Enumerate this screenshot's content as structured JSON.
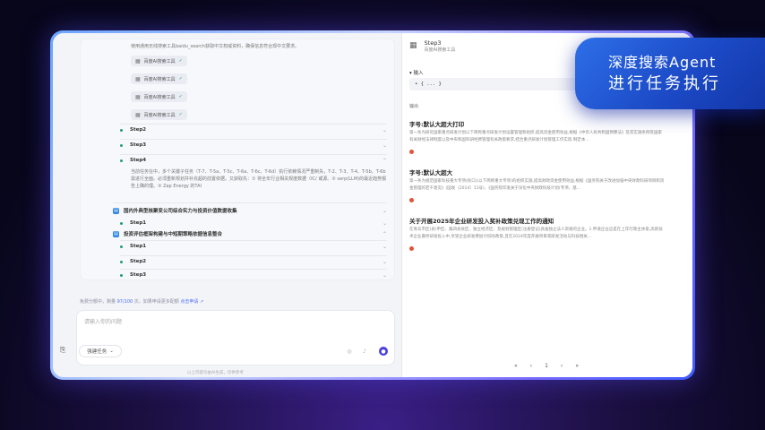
{
  "badge": {
    "line1": "深度搜索Agent",
    "line2": "进行任务执行"
  },
  "left": {
    "intro_text": "使用通用无线搜索工具baidu_search获取中文权威资料，确保信息符合现中文要求。",
    "tool_chips": [
      "百度AI搜索工具",
      "百度AI搜索工具",
      "百度AI搜索工具",
      "百度AI搜索工具"
    ],
    "steps_a": [
      "Step2",
      "Step3",
      "Step4"
    ],
    "step4_detail": "当前任务在中，多个关键子任务（T-7、T-5a、T-5c、T-6a、T-6c、T-6d）执行依赖情况严重制失，T-2、T-3、T-4、T-5b、T-6b 需进行全面。必须重新规划并补充超的前置依据。又获取先：① 将全年行业相关规度数据（IC/ 或源。② serp(LLM)的最近趋势报告上确的理。③ Zap Energy 的TAI",
    "task1": "国内外典型核聚变公司综合实力与投资价值数据收集",
    "task1_steps": [
      "Step1"
    ],
    "task2": "投资评估框架构建与中短期策略依据信息整合",
    "task2_steps": [
      "Step1",
      "Step2",
      "Step3"
    ],
    "quota_prefix": "免费分额中，剩量",
    "quota_value": "97/100",
    "quota_mid": "次，如果申请更多配额",
    "quota_link": "点击申请 ↗",
    "input_placeholder": "请输入你的问题",
    "mode_label": "强建任务",
    "footer_note": "以上内容均由AI生成，仅供参考"
  },
  "right": {
    "step_title": "Step3",
    "step_sub": "百度AI搜索工具",
    "input_label": "输入",
    "input_code": "• { ... }",
    "output_label": "输出",
    "results": [
      {
        "title": "字号:默认大超大打印",
        "body": "第一条为研究国家重点研发计划以下简称重点研发计划设置管理和组织,提高资金使用效益,根据《中华人民共和国预算法》及其实施条例等国家有关财经法律制度以及中央和国科研经费管理有关政策要求,结合重点研发计划管理工作实际,制定本..."
      },
      {
        "title": "字号:默认大超大",
        "body": "第一条为规范国家科技重大专项(民口)(以下简称重大专项)的组织实施,提高财政资金使用效益,根据《国务院关于改进加强中央财政科研项目和资金管理的若干意见》(国发〔2014〕11号)、《国务院印发关于深化中央财政科技计划(专项、基..."
      },
      {
        "title": "关于开展2025年企业研发投入奖补政策兑现工作的通知",
        "body": "在青岛市区(县)申区、集四县县区、独立经济区、及规划管理区(注册登记)具备独立法人资格的企业。1.申请企业应是在上年行政主体第,高新技术企业最终研发投入中,享受企业研发费加计扣除政策,且在2024年度开展项目或研发活动与科技相关..."
      }
    ],
    "pager": [
      "«",
      "‹",
      "1",
      "›",
      "»"
    ]
  }
}
